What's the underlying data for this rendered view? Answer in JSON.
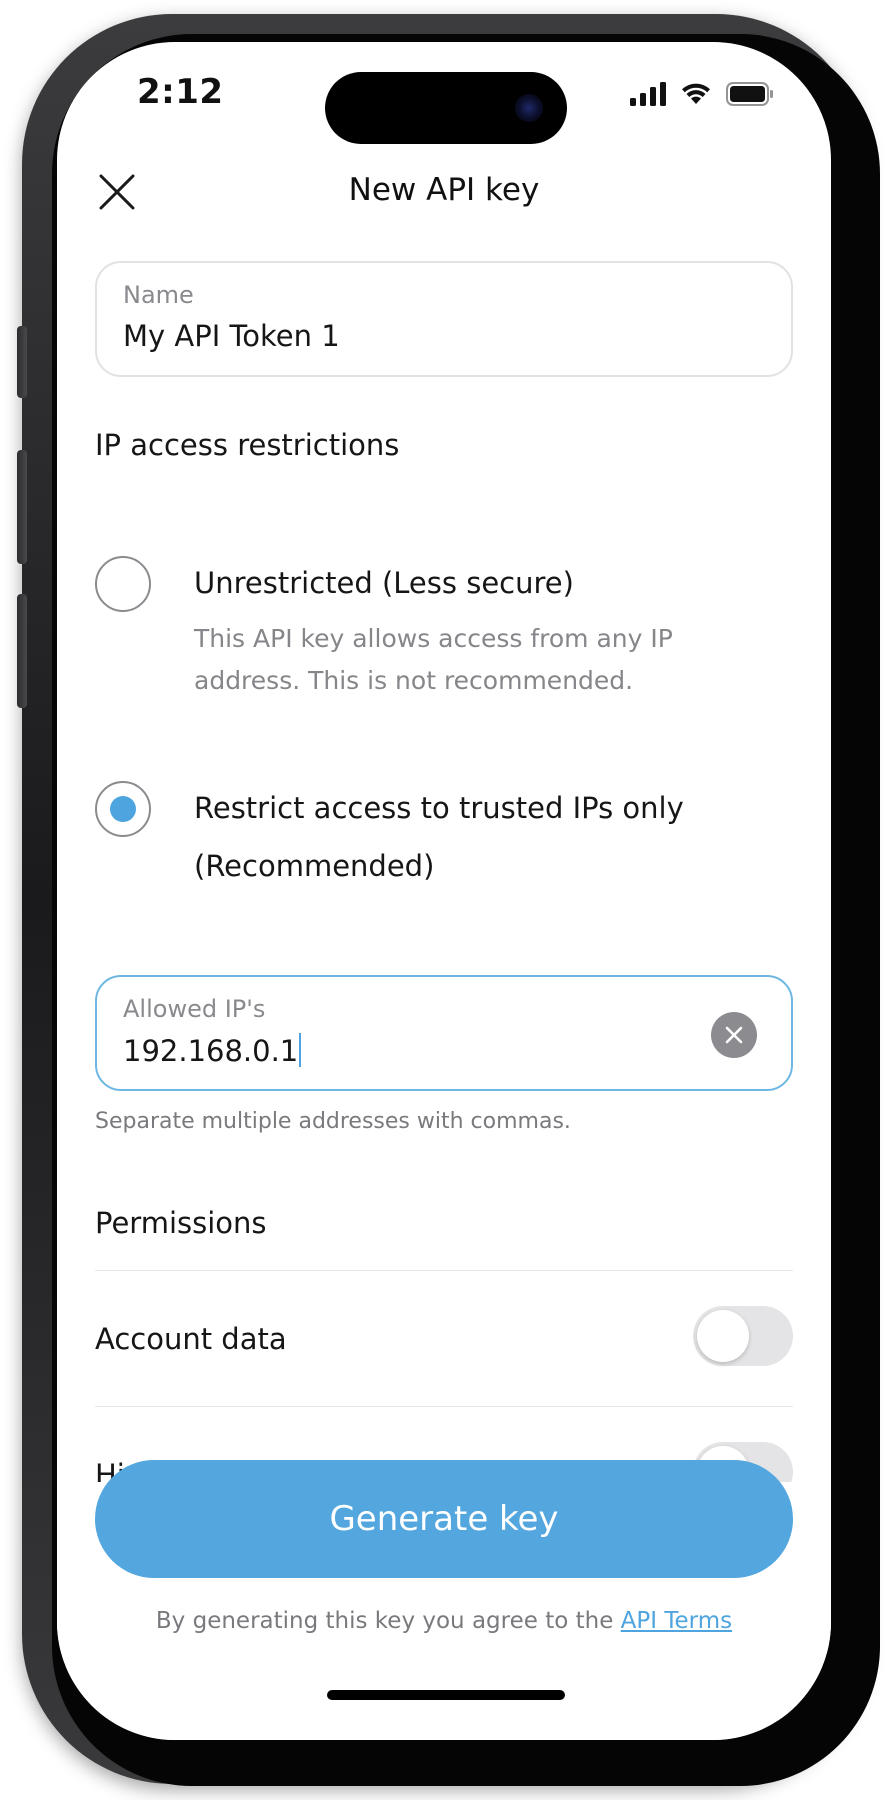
{
  "status_bar": {
    "time": "2:12"
  },
  "header": {
    "title": "New API key",
    "close_icon": "close-icon"
  },
  "name_field": {
    "label": "Name",
    "value": "My API Token 1"
  },
  "ip_access": {
    "section_title": "IP access restrictions",
    "options": [
      {
        "label": "Unrestricted (Less secure)",
        "description": "This API key allows access from any IP address. This is not recommended.",
        "selected": false
      },
      {
        "label": "Restrict access to trusted IPs only (Recommended)",
        "selected": true
      }
    ]
  },
  "allowed_ips_field": {
    "label": "Allowed IP's",
    "value": "192.168.0.1",
    "helper": "Separate multiple addresses with commas."
  },
  "permissions": {
    "section_title": "Permissions",
    "items": [
      {
        "label": "Account data",
        "enabled": false
      },
      {
        "label": "History",
        "enabled": false
      }
    ]
  },
  "footer": {
    "button_label": "Generate key",
    "terms_prefix": "By generating this key you agree to the ",
    "terms_link": "API Terms"
  },
  "colors": {
    "accent": "#53a6de",
    "radio_fill": "#4ea4de",
    "toggle_off": "#e4e4e6"
  }
}
